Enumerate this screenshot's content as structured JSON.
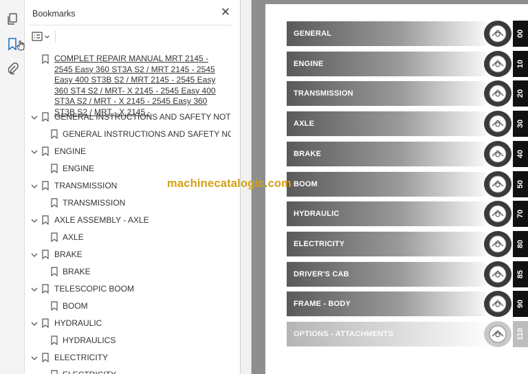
{
  "bookmarks_panel": {
    "title": "Bookmarks",
    "close_glyph": "✕",
    "root": {
      "label": "COMPLET REPAIR MANUAL   MRT 2145 - 2545 Easy 360 ST3A S2 / MRT 2145 - 2545 Easy 400 ST3B S2 / MRT 2145 - 2545 Easy 360 ST4 S2 / MRT- X 2145 - 2545 Easy 400 ST3A S2 / MRT - X 2145 - 2545 Easy 360 ST3B S2 / MRT - X 2145 -"
    },
    "items": [
      {
        "label": "GENERAL INSTRUCTIONS AND SAFETY NOTICE",
        "child": "GENERAL INSTRUCTIONS AND SAFETY NOTICE"
      },
      {
        "label": "ENGINE",
        "child": "ENGINE"
      },
      {
        "label": "TRANSMISSION",
        "child": "TRANSMISSION"
      },
      {
        "label": "AXLE ASSEMBLY - AXLE",
        "child": "AXLE"
      },
      {
        "label": "BRAKE",
        "child": "BRAKE"
      },
      {
        "label": "TELESCOPIC BOOM",
        "child": "BOOM"
      },
      {
        "label": "HYDRAULIC",
        "child": "HYDRAULICS"
      },
      {
        "label": "ELECTRICITY",
        "child": "ELECTRICITY"
      }
    ]
  },
  "rail_icons": [
    "copy-pages-icon",
    "bookmark-icon",
    "attachment-icon"
  ],
  "document": {
    "tabs": [
      {
        "label": "GENERAL",
        "num": "00",
        "icon": "book-wrench-icon"
      },
      {
        "label": "ENGINE",
        "num": "10",
        "icon": "engine-icon"
      },
      {
        "label": "TRANSMISSION",
        "num": "20",
        "icon": "gears-icon"
      },
      {
        "label": "AXLE",
        "num": "30",
        "icon": "axle-icon"
      },
      {
        "label": "BRAKE",
        "num": "40",
        "icon": "brake-disc-icon"
      },
      {
        "label": "BOOM",
        "num": "50",
        "icon": "boom-icon"
      },
      {
        "label": "HYDRAULIC",
        "num": "70",
        "icon": "cylinder-icon"
      },
      {
        "label": "ELECTRICITY",
        "num": "80",
        "icon": "battery-icon"
      },
      {
        "label": "DRIVER'S CAB",
        "num": "85",
        "icon": "cab-icon"
      },
      {
        "label": "FRAME - BODY",
        "num": "90",
        "icon": "chassis-icon"
      },
      {
        "label": "OPTIONS - ATTACHMENTS",
        "num": "110",
        "icon": "fork-icon"
      }
    ]
  },
  "watermark": "machinecatalogic.com",
  "colors": {
    "tab_dark": "#5a5a5a",
    "tab_light": "#ffffff",
    "tab_faded": "#b5b5b5",
    "watermark": "#d4a017",
    "accent_blue": "#1a6fd1"
  }
}
